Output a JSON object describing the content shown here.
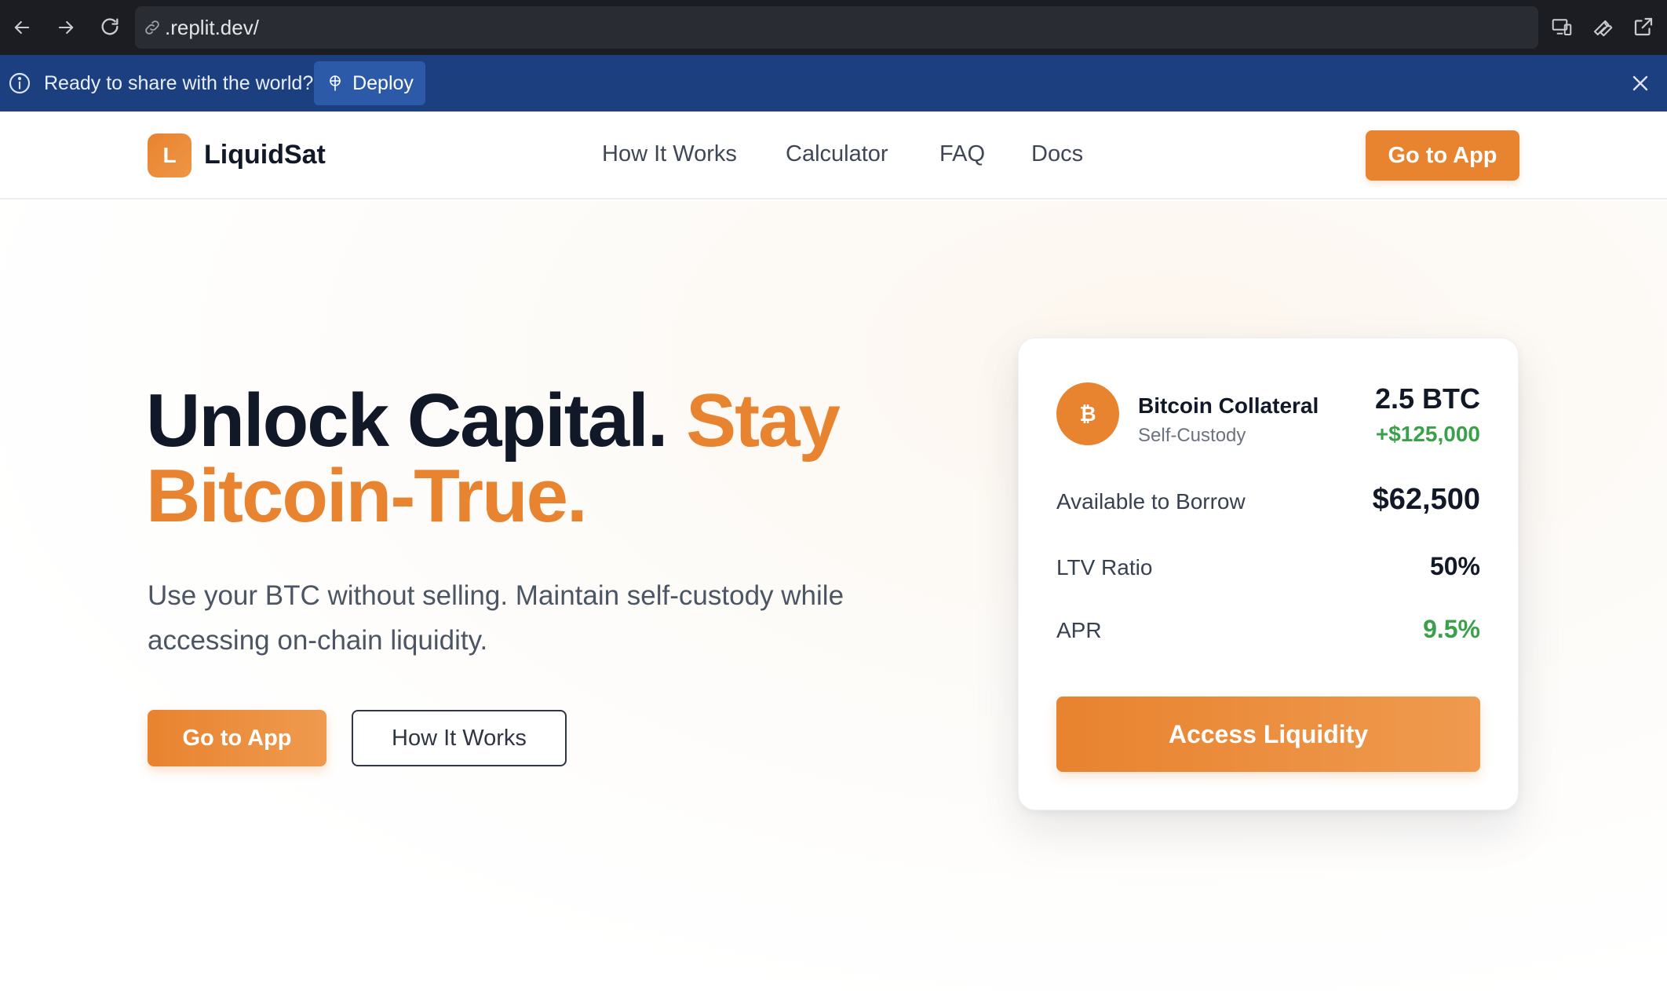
{
  "browser": {
    "url": ".replit.dev/",
    "icons": [
      "back-arrow-icon",
      "forward-arrow-icon",
      "reload-icon",
      "link-icon",
      "devices-icon",
      "wrench-icon",
      "external-link-icon"
    ]
  },
  "banner": {
    "message": "Ready to share with the world?",
    "deploy_label": "Deploy",
    "background": "#1c3f80"
  },
  "header": {
    "logo_letter": "L",
    "brand": "LiquidSat",
    "nav": [
      "How It Works",
      "Calculator",
      "FAQ",
      "Docs"
    ],
    "cta_label": "Go to App"
  },
  "hero": {
    "headline_dark": "Unlock Capital.",
    "headline_accent_1": "Stay",
    "headline_accent_2": "Bitcoin-True.",
    "subhead": "Use your BTC without selling. Maintain self-custody while accessing on-chain liquidity.",
    "primary_cta": "Go to App",
    "secondary_cta": "How It Works"
  },
  "card": {
    "badge_symbol": "₿",
    "asset_name": "Bitcoin Collateral",
    "asset_sub": "Self-Custody",
    "amount": "2.5 BTC",
    "amount_usd": "+$125,000",
    "rows": [
      {
        "label": "Available to Borrow",
        "value": "$62,500"
      },
      {
        "label": "LTV Ratio",
        "value": "50%"
      },
      {
        "label": "APR",
        "value": "9.5%"
      }
    ],
    "cta_label": "Access Liquidity"
  },
  "colors": {
    "accent": "#e8832f",
    "positive": "#3aa14a",
    "text_dark": "#111827"
  }
}
